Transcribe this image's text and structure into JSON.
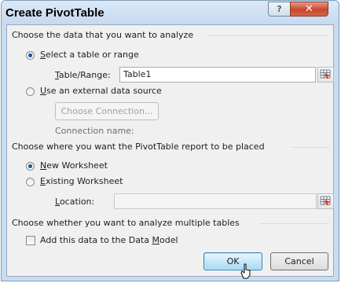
{
  "dialog": {
    "title": "Create PivotTable",
    "help_label": "?",
    "close_label": "✕"
  },
  "source_section": {
    "header": "Choose the data that you want to analyze",
    "select_table": {
      "label_underline": "S",
      "label_rest": "elect a table or range",
      "selected": true
    },
    "table_range": {
      "label_underline": "T",
      "label_rest": "able/Range:",
      "value": "Table1"
    },
    "external": {
      "label_underline": "U",
      "label_rest": "se an external data source",
      "selected": false
    },
    "choose_connection_label": "Choose Connection...",
    "connection_name_label": "Connection name:"
  },
  "placement_section": {
    "header": "Choose where you want the PivotTable report to be placed",
    "new_worksheet": {
      "label_underline": "N",
      "label_rest": "ew Worksheet",
      "selected": true
    },
    "existing_worksheet": {
      "label_underline": "E",
      "label_rest": "xisting Worksheet",
      "selected": false
    },
    "location": {
      "label_underline": "L",
      "label_rest": "ocation:",
      "value": ""
    }
  },
  "multiple_section": {
    "header": "Choose whether you want to analyze multiple tables",
    "data_model": {
      "label_pre": "Add this data to the Data ",
      "label_underline": "M",
      "label_rest": "odel",
      "checked": false
    }
  },
  "buttons": {
    "ok_label": "OK",
    "cancel_label": "Cancel"
  }
}
